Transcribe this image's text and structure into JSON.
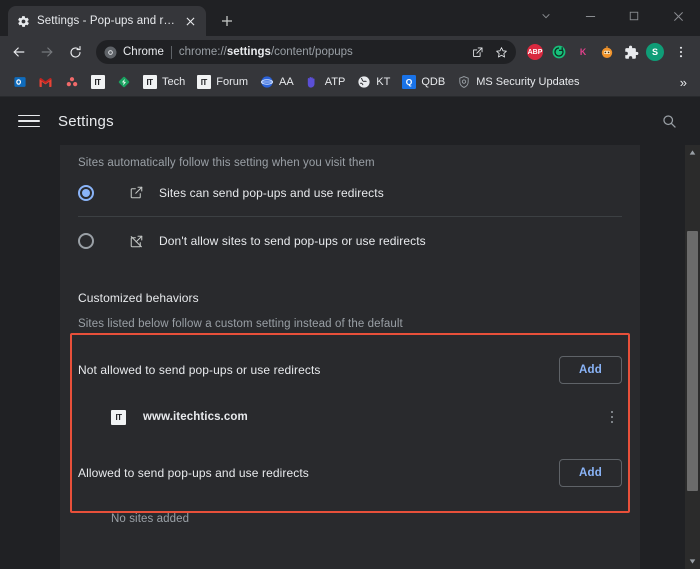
{
  "window": {
    "controls": [
      {
        "name": "tab-search",
        "glyph": "⌄"
      },
      {
        "name": "minimize",
        "glyph": "—"
      },
      {
        "name": "maximize",
        "glyph": "□"
      },
      {
        "name": "close",
        "glyph": "✕"
      }
    ]
  },
  "tab": {
    "title": "Settings - Pop-ups and redirects",
    "favicon": "gear-icon",
    "close_label": "✕",
    "newtab_label": "+"
  },
  "toolbar": {
    "back_label": "←",
    "forward_label": "→",
    "reload_label": "⟳",
    "omnibox": {
      "chip_label": "Chrome",
      "url_prefix": "chrome://",
      "url_bold": "settings",
      "url_suffix": "/content/popups",
      "full_url": "chrome://settings/content/popups",
      "share_label": "share-icon",
      "bookmark_label": "star-icon"
    },
    "extensions": [
      {
        "name": "adblock-plus",
        "label": "ABP",
        "color": "#d9293f"
      },
      {
        "name": "green-extension",
        "label": "",
        "color": "#17c07a"
      },
      {
        "name": "k-extension",
        "label": "K",
        "color": "#e0408a"
      },
      {
        "name": "orange-extension",
        "label": "",
        "color": "#f0932b"
      },
      {
        "name": "extensions-puzzle",
        "label": "",
        "color": "#e8eaed"
      }
    ],
    "profile": {
      "label": "S",
      "color": "#0f9d77"
    },
    "menu_label": "⋮"
  },
  "bookmarks": {
    "items": [
      {
        "name": "outlook",
        "label": "",
        "icon": "outlook",
        "color": "#0f6cbd"
      },
      {
        "name": "gmail",
        "label": "",
        "icon": "gmail",
        "color": "#ea4335"
      },
      {
        "name": "asana",
        "label": "",
        "icon": "asana",
        "color": "#f06a6a"
      },
      {
        "name": "itechtics",
        "label": "",
        "icon": "it-box",
        "color": "#f1f3f4"
      },
      {
        "name": "green-diamond",
        "label": "",
        "icon": "diamond",
        "color": "#1aa260"
      },
      {
        "name": "tech",
        "label": "Tech",
        "icon": "it-box",
        "color": "#f1f3f4"
      },
      {
        "name": "forum",
        "label": "Forum",
        "icon": "it-box",
        "color": "#f1f3f4"
      },
      {
        "name": "aa",
        "label": "AA",
        "icon": "blue-globe",
        "color": "#2b62d9"
      },
      {
        "name": "atp",
        "label": "ATP",
        "icon": "purple-hand",
        "color": "#5b4fd6"
      },
      {
        "name": "kt",
        "label": "KT",
        "icon": "globe",
        "color": "#e8eaed"
      },
      {
        "name": "qdb",
        "label": "QDB",
        "icon": "q-box",
        "color": "#1a73e8"
      },
      {
        "name": "ms-security-updates",
        "label": "MS Security Updates",
        "icon": "shield",
        "color": "#9aa0a6"
      }
    ],
    "overflow_label": "»"
  },
  "settings": {
    "menu_label": "hamburger-icon",
    "title": "Settings",
    "search_label": "search-icon"
  },
  "page": {
    "default_hint": "Sites automatically follow this setting when you visit them",
    "radio_options": [
      {
        "name": "allow-popups",
        "label": "Sites can send pop-ups and use redirects",
        "icon": "open-in-new-icon",
        "selected": true
      },
      {
        "name": "block-popups",
        "label": "Don't allow sites to send pop-ups or use redirects",
        "icon": "open-in-new-off-icon",
        "selected": false
      }
    ],
    "customized_title": "Customized behaviors",
    "customized_sub": "Sites listed below follow a custom setting instead of the default",
    "blocked_section": {
      "label": "Not allowed to send pop-ups or use redirects",
      "add_label": "Add",
      "sites": [
        {
          "name": "www.itechtics.com",
          "favicon": "IT",
          "more_label": "⋮"
        }
      ]
    },
    "allowed_section": {
      "label": "Allowed to send pop-ups and use redirects",
      "add_label": "Add",
      "empty_label": "No sites added",
      "sites": []
    },
    "highlight_color": "#e8503a",
    "accent_color": "#8ab4f8"
  },
  "scrollbar": {
    "up_label": "▲",
    "down_label": "▼"
  }
}
